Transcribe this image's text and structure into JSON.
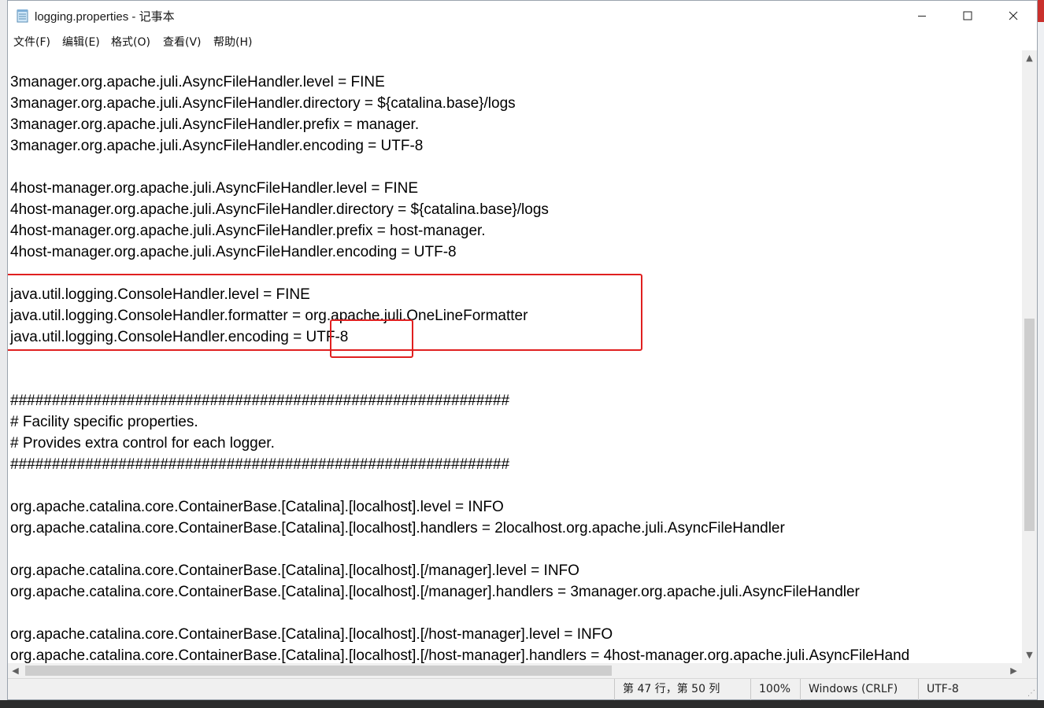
{
  "window": {
    "title": "logging.properties - 记事本",
    "minimize_icon": "minimize-icon",
    "maximize_icon": "maximize-icon",
    "close_icon": "close-icon"
  },
  "menu": [
    "文件(F)",
    "编辑(E)",
    "格式(O)",
    "查看(V)",
    "帮助(H)"
  ],
  "lines": [
    "3manager.org.apache.juli.AsyncFileHandler.level = FINE",
    "3manager.org.apache.juli.AsyncFileHandler.directory = ${catalina.base}/logs",
    "3manager.org.apache.juli.AsyncFileHandler.prefix = manager.",
    "3manager.org.apache.juli.AsyncFileHandler.encoding = UTF-8",
    "",
    "4host-manager.org.apache.juli.AsyncFileHandler.level = FINE",
    "4host-manager.org.apache.juli.AsyncFileHandler.directory = ${catalina.base}/logs",
    "4host-manager.org.apache.juli.AsyncFileHandler.prefix = host-manager.",
    "4host-manager.org.apache.juli.AsyncFileHandler.encoding = UTF-8",
    "",
    "java.util.logging.ConsoleHandler.level = FINE",
    "java.util.logging.ConsoleHandler.formatter = org.apache.juli.OneLineFormatter",
    "java.util.logging.ConsoleHandler.encoding = UTF-8",
    "",
    "",
    "############################################################",
    "# Facility specific properties.",
    "# Provides extra control for each logger.",
    "############################################################",
    "",
    "org.apache.catalina.core.ContainerBase.[Catalina].[localhost].level = INFO",
    "org.apache.catalina.core.ContainerBase.[Catalina].[localhost].handlers = 2localhost.org.apache.juli.AsyncFileHandler",
    "",
    "org.apache.catalina.core.ContainerBase.[Catalina].[localhost].[/manager].level = INFO",
    "org.apache.catalina.core.ContainerBase.[Catalina].[localhost].[/manager].handlers = 3manager.org.apache.juli.AsyncFileHandler",
    "",
    "org.apache.catalina.core.ContainerBase.[Catalina].[localhost].[/host-manager].level = INFO",
    "org.apache.catalina.core.ContainerBase.[Catalina].[localhost].[/host-manager].handlers = 4host-manager.org.apache.juli.AsyncFileHand"
  ],
  "status": {
    "position": "第 47 行，第 50 列",
    "zoom": "100%",
    "line_ending": "Windows (CRLF)",
    "encoding": "UTF-8"
  },
  "colors": {
    "highlight": "#e02020"
  }
}
